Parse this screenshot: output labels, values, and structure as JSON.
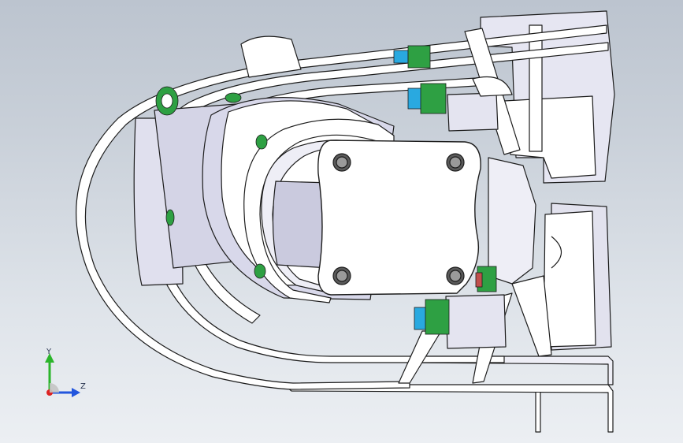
{
  "viewport": {
    "background_top": "#bcc4cf",
    "background_bottom": "#eceff3"
  },
  "model": {
    "part_fill": "#ffffff",
    "part_shade": "#dcdcf0",
    "part_dark": "#a8a8c4",
    "edge_color": "#1c1c1c",
    "bolt_green": "#2ea043",
    "bolt_cyan": "#29a9e0",
    "accent_red": "#c0504d"
  },
  "triad": {
    "y_label": "Y",
    "z_label": "Z",
    "y_color": "#2bb52b",
    "z_color": "#2255dd",
    "x_color": "#dd2222"
  }
}
